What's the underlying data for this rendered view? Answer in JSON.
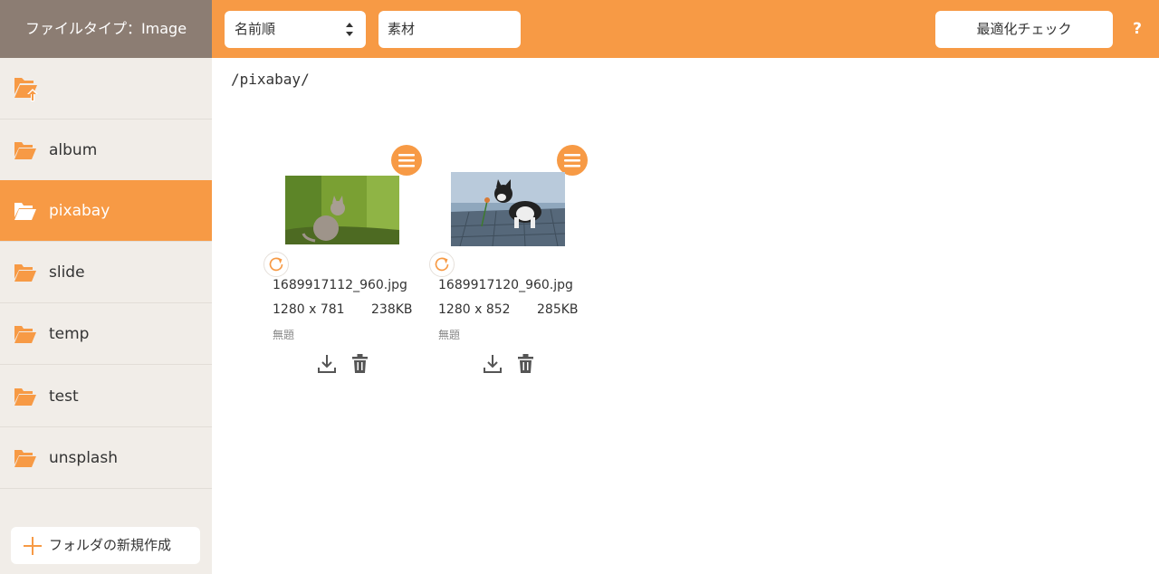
{
  "header": {
    "filetype_label": "ファイルタイプ：Image",
    "sort_select": "名前順",
    "search_value": "素材",
    "optimize_button": "最適化チェック",
    "help_label": "?"
  },
  "sidebar": {
    "up_icon": "folder-up-icon",
    "items": [
      {
        "label": "album",
        "active": false
      },
      {
        "label": "pixabay",
        "active": true
      },
      {
        "label": "slide",
        "active": false
      },
      {
        "label": "temp",
        "active": false
      },
      {
        "label": "test",
        "active": false
      },
      {
        "label": "unsplash",
        "active": false
      }
    ],
    "new_folder_label": "フォルダの新規作成"
  },
  "main": {
    "path": "/pixabay/",
    "files": [
      {
        "name": "1689917112_960.jpg",
        "dims": "1280 x 781",
        "size": "238KB",
        "caption": "無題"
      },
      {
        "name": "1689917120_960.jpg",
        "dims": "1280 x 852",
        "size": "285KB",
        "caption": "無題"
      }
    ]
  },
  "colors": {
    "accent": "#f79a45",
    "sidebar_bg": "#f1ede8",
    "filetype_bg": "#8c7d73"
  }
}
